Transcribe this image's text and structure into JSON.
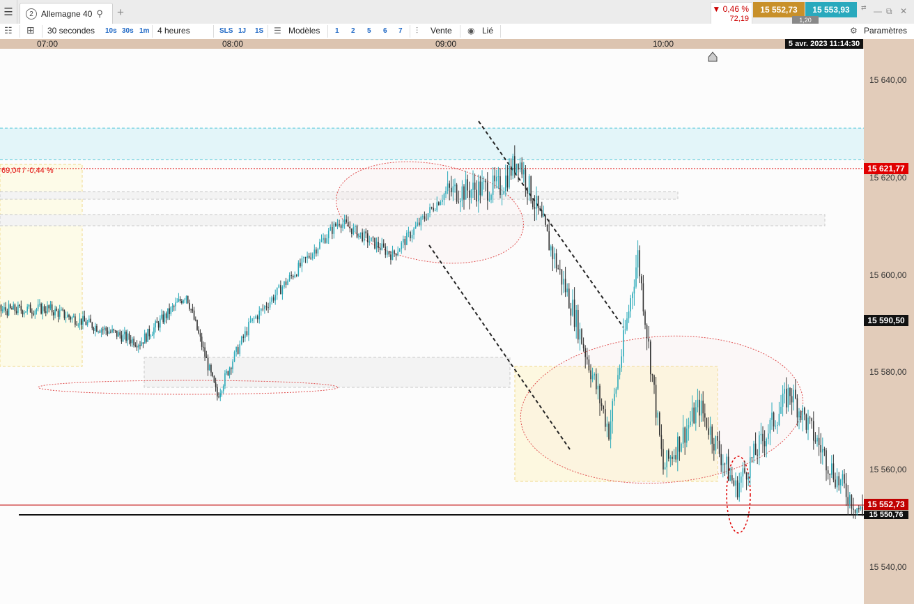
{
  "tabbar": {
    "tab_number": "2",
    "instrument": "Allemagne 40",
    "quote_pct": "▼ 0,46 %",
    "quote_change": "72,19",
    "bid": "15 552,73",
    "ask": "15 553,93",
    "spread": "1,20"
  },
  "toolbar": {
    "interval": "30 secondes",
    "btn_10s": "10s",
    "btn_30s": "30s",
    "btn_1m": "1m",
    "range": "4 heures",
    "btn_sls": "SLS",
    "btn_1j": "1J",
    "btn_1s": "1S",
    "models": "Modèles",
    "n1": "1",
    "n2": "2",
    "n5": "5",
    "n6": "6",
    "n7": "7",
    "sell": "Vente",
    "linked": "Lié",
    "settings": "Paramètres"
  },
  "chart_data": {
    "type": "candlestick",
    "x_ticks": [
      "07:00",
      "08:00",
      "09:00",
      "10:00"
    ],
    "date_label": "5 avr. 2023 11:14:30",
    "y_ticks": [
      "15 640,00",
      "15 620,00",
      "15 600,00",
      "15 580,00",
      "15 560,00",
      "15 540,00"
    ],
    "ylim": [
      15535,
      15648
    ],
    "price_tags": {
      "prev_close": "15 621,77",
      "level": "15 590,50",
      "bid": "15 552,73",
      "support": "15 550,76"
    },
    "prev_close_note": "69,04 / -0,44 %",
    "colors": {
      "up": "#2aaab9",
      "down": "#333333",
      "prev_close": "#e00000",
      "bid": "#c00000"
    },
    "key_points": [
      {
        "t": "06:15",
        "p": 15594
      },
      {
        "t": "07:00",
        "p": 15595
      },
      {
        "t": "07:30",
        "p": 15588
      },
      {
        "t": "07:45",
        "p": 15598
      },
      {
        "t": "07:55",
        "p": 15577
      },
      {
        "t": "08:05",
        "p": 15592
      },
      {
        "t": "08:30",
        "p": 15613
      },
      {
        "t": "08:45",
        "p": 15606
      },
      {
        "t": "09:00",
        "p": 15619
      },
      {
        "t": "09:15",
        "p": 15620
      },
      {
        "t": "09:20",
        "p": 15626
      },
      {
        "t": "09:35",
        "p": 15595
      },
      {
        "t": "09:45",
        "p": 15570
      },
      {
        "t": "09:53",
        "p": 15606
      },
      {
        "t": "10:00",
        "p": 15562
      },
      {
        "t": "10:10",
        "p": 15575
      },
      {
        "t": "10:20",
        "p": 15558
      },
      {
        "t": "10:35",
        "p": 15578
      },
      {
        "t": "10:48",
        "p": 15560
      },
      {
        "t": "10:55",
        "p": 15552.7
      }
    ]
  }
}
